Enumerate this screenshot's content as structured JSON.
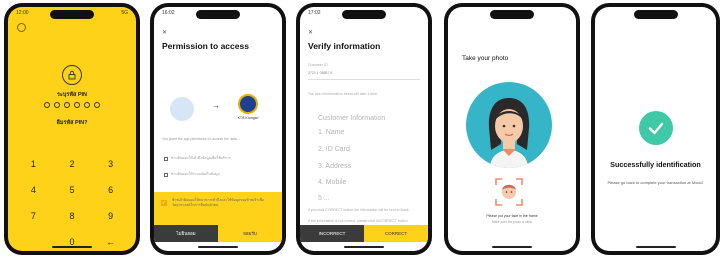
{
  "screens": {
    "pin": {
      "time": "12:00",
      "network": "5G",
      "title": "ระบุรหัส PIN",
      "forgot": "ลืมรหัส PIN?",
      "keys": [
        "1",
        "2",
        "3",
        "4",
        "5",
        "6",
        "7",
        "8",
        "9",
        "",
        "0",
        "←"
      ],
      "bg_color": "#ffd21a"
    },
    "permission": {
      "time": "16:02",
      "title": "Permission to access",
      "bank": "KTB Krungsri",
      "body": "You grant the app permission to access the data...",
      "opt1": "ท่านยินยอมให้เข้าถึงข้อมูลเพื่อใช้บริการ",
      "opt2": "ท่านยินยอมให้ระบบจัดเก็บข้อมูล",
      "consent": "ข้าพเจ้ายินยอมให้ธนาคารเข้าถึงและใช้ข้อมูลของข้าพเจ้าเพื่อวัตถุประสงค์ในการยืนยันตัวตน",
      "decline": "ไม่ยินยอม",
      "accept": "ยอมรับ"
    },
    "verify": {
      "time": "17:02",
      "title": "Verify information",
      "id_label": "Customer ID",
      "id_value": "3721 1 08857 6",
      "notice": "The use of information below will take 3 tries.",
      "section": "Customer Information",
      "items": [
        "1. Name",
        "2. ID Card",
        "3. Address",
        "4. Mobile",
        "5 ..."
      ],
      "footnote1": "If you click CORRECT button the information will be sent to Bank.",
      "footnote2": "If the information is not correct, please click INCORRECT button.",
      "incorrect": "INCORRECT",
      "correct": "CORRECT"
    },
    "photo": {
      "title": "Take your photo",
      "caption": "Please put your face in the frame",
      "sub": "Make sure the photo is clear",
      "ring_color": "#36b5c9"
    },
    "success": {
      "title": "Successfully identification",
      "sub": "Please go back to complete your transaction at Mock2",
      "check_color": "#3fc9a6"
    }
  }
}
